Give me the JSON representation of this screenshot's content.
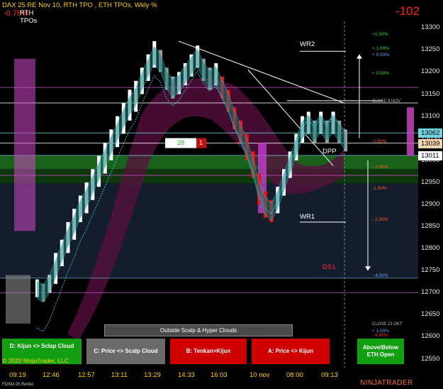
{
  "header": {
    "title": "DAX 25 RE Nov 10, RTH TPO , ETH TPOs, Wkly %",
    "change": "-0.78%",
    "rth_label": "RTH",
    "tpos_label": "TPOs",
    "points": "-102"
  },
  "chart_data": {
    "type": "candlestick",
    "instrument": "FDXM 25 Renko",
    "x_tick_labels": [
      "09:19",
      "12:46",
      "12:57",
      "13:11",
      "13:29",
      "14:33",
      "16:03",
      "10 nov",
      "08:00",
      "09:13"
    ],
    "y_tick_labels": [
      "13300",
      "13250",
      "13200",
      "13150",
      "13100",
      "13050",
      "13000",
      "12950",
      "12900",
      "12850",
      "12800",
      "12750",
      "12700",
      "12650",
      "12600",
      "12550"
    ],
    "ylim": [
      12530,
      13315
    ],
    "price_tags": [
      {
        "label": "13062",
        "value": 13062,
        "color": "#6fd4e0"
      },
      {
        "label": "13039",
        "value": 13039,
        "color": "#f2d6b0"
      },
      {
        "label": "13011",
        "value": 13011,
        "color": "#ffffff"
      }
    ],
    "level_labels": [
      {
        "label": "WR2",
        "value": 13250,
        "color": "#ffffff"
      },
      {
        "label": "WR1",
        "value": 12860,
        "color": "#ffffff"
      },
      {
        "label": "DPP",
        "value": 13007,
        "color": "#ffffff"
      },
      {
        "label": "DS1",
        "value": 12745,
        "color": "#ff3030"
      }
    ],
    "weekly_percent_levels": [
      {
        "label": "+1.50%",
        "value": 13285,
        "color": "#33dd33"
      },
      {
        "label": "+ 1.00%",
        "value": 13252,
        "color": "#33dd33"
      },
      {
        "label": "+ 0.00%",
        "value": 13237,
        "color": "#6fa0ff"
      },
      {
        "label": "+ 0.50%",
        "value": 13196,
        "color": "#33dd33"
      },
      {
        "label": "-0.50%",
        "value": 13041,
        "color": "#ff6030"
      },
      {
        "label": "- 1.00%",
        "value": 12983,
        "color": "#ff6030"
      },
      {
        "label": "-1.50%",
        "value": 12935,
        "color": "#ff6030"
      },
      {
        "label": "- 2.00%",
        "value": 12865,
        "color": "#ff6030"
      },
      {
        "label": "- 4.00%",
        "value": 12738,
        "color": "#6fa0ff"
      },
      {
        "label": "+ 1.00%",
        "value": 12612,
        "color": "#6fa0ff"
      },
      {
        "label": "- 4.90%",
        "value": 12602,
        "color": "#ff3030"
      }
    ],
    "annotations": [
      {
        "label": "CLOSE 9 NOV",
        "value": 13130
      },
      {
        "label": "CLOSE 23 OKT",
        "value": 12625
      },
      {
        "label": "28",
        "value": 13039,
        "color": "#22aa22"
      },
      {
        "label": "1",
        "value": 13039,
        "color": "#ff3030"
      }
    ],
    "horizontal_lines": [
      {
        "value": 13165,
        "color": "#c050c0"
      },
      {
        "value": 13130,
        "color": "#ffffff"
      },
      {
        "value": 13062,
        "color": "#6fd4e0"
      },
      {
        "value": 13039,
        "color": "#ffffff"
      },
      {
        "value": 13011,
        "color": "#6fd4e0"
      },
      {
        "value": 12966,
        "color": "#c050c0"
      },
      {
        "value": 12733,
        "color": "#5aa0d0"
      },
      {
        "value": 12700,
        "color": "#c050c0"
      }
    ],
    "zones": [
      {
        "from": 12980,
        "to": 13010,
        "color": "#1d6b1d"
      },
      {
        "from": 12948,
        "to": 12980,
        "color": "#0f3d0f"
      },
      {
        "from": 12733,
        "to": 12948,
        "color": "#152030"
      }
    ],
    "renko_bricks": [
      {
        "bar": 0,
        "low": 12690,
        "high": 12730,
        "up": true
      },
      {
        "bar": 1,
        "low": 12680,
        "high": 12720,
        "up": false
      },
      {
        "bar": 2,
        "low": 12700,
        "high": 12740,
        "up": true
      },
      {
        "bar": 3,
        "low": 12720,
        "high": 12790,
        "up": true
      },
      {
        "bar": 4,
        "low": 12760,
        "high": 12820,
        "up": true
      },
      {
        "bar": 5,
        "low": 12790,
        "high": 12860,
        "up": true
      },
      {
        "bar": 6,
        "low": 12820,
        "high": 12890,
        "up": true
      },
      {
        "bar": 7,
        "low": 12860,
        "high": 12920,
        "up": true
      },
      {
        "bar": 8,
        "low": 12880,
        "high": 12950,
        "up": true
      },
      {
        "bar": 9,
        "low": 12910,
        "high": 12980,
        "up": true
      },
      {
        "bar": 10,
        "low": 12940,
        "high": 13010,
        "up": true
      },
      {
        "bar": 11,
        "low": 12970,
        "high": 13040,
        "up": true
      },
      {
        "bar": 12,
        "low": 13000,
        "high": 13070,
        "up": true
      },
      {
        "bar": 13,
        "low": 13030,
        "high": 13100,
        "up": true
      },
      {
        "bar": 14,
        "low": 13060,
        "high": 13130,
        "up": true
      },
      {
        "bar": 15,
        "low": 13090,
        "high": 13160,
        "up": true
      },
      {
        "bar": 16,
        "low": 13110,
        "high": 13180,
        "up": true
      },
      {
        "bar": 17,
        "low": 13150,
        "high": 13210,
        "up": true
      },
      {
        "bar": 18,
        "low": 13180,
        "high": 13240,
        "up": true
      },
      {
        "bar": 19,
        "low": 13210,
        "high": 13270,
        "up": true
      },
      {
        "bar": 20,
        "low": 13200,
        "high": 13250,
        "up": false
      },
      {
        "bar": 21,
        "low": 13160,
        "high": 13210,
        "up": false
      },
      {
        "bar": 22,
        "low": 13140,
        "high": 13190,
        "up": false
      },
      {
        "bar": 23,
        "low": 13150,
        "high": 13200,
        "up": true
      },
      {
        "bar": 24,
        "low": 13170,
        "high": 13220,
        "up": true
      },
      {
        "bar": 25,
        "low": 13190,
        "high": 13240,
        "up": true
      },
      {
        "bar": 26,
        "low": 13210,
        "high": 13260,
        "up": true
      },
      {
        "bar": 27,
        "low": 13180,
        "high": 13230,
        "up": false
      },
      {
        "bar": 28,
        "low": 13160,
        "high": 13210,
        "up": false
      },
      {
        "bar": 29,
        "low": 13170,
        "high": 13220,
        "up": true
      },
      {
        "bar": 30,
        "low": 13140,
        "high": 13190,
        "up": false
      },
      {
        "bar": 31,
        "low": 13110,
        "high": 13160,
        "up": false
      },
      {
        "bar": 32,
        "low": 13070,
        "high": 13120,
        "up": false
      },
      {
        "bar": 33,
        "low": 13040,
        "high": 13090,
        "up": false
      },
      {
        "bar": 34,
        "low": 13000,
        "high": 13060,
        "up": false
      },
      {
        "bar": 35,
        "low": 12960,
        "high": 13020,
        "up": false
      },
      {
        "bar": 36,
        "low": 12900,
        "high": 12970,
        "up": false
      },
      {
        "bar": 37,
        "low": 12870,
        "high": 12930,
        "up": false
      },
      {
        "bar": 38,
        "low": 12860,
        "high": 12910,
        "up": false
      },
      {
        "bar": 39,
        "low": 12880,
        "high": 12940,
        "up": true
      },
      {
        "bar": 40,
        "low": 12920,
        "high": 12980,
        "up": true
      },
      {
        "bar": 41,
        "low": 12960,
        "high": 13020,
        "up": true
      },
      {
        "bar": 42,
        "low": 13000,
        "high": 13060,
        "up": true
      },
      {
        "bar": 43,
        "low": 13040,
        "high": 13100,
        "up": true
      },
      {
        "bar": 44,
        "low": 13060,
        "high": 13110,
        "up": true
      },
      {
        "bar": 45,
        "low": 13040,
        "high": 13090,
        "up": false
      },
      {
        "bar": 46,
        "low": 13060,
        "high": 13110,
        "up": true
      },
      {
        "bar": 47,
        "low": 13040,
        "high": 13090,
        "up": false
      },
      {
        "bar": 48,
        "low": 13060,
        "high": 13110,
        "up": true
      },
      {
        "bar": 49,
        "low": 13040,
        "high": 13090,
        "up": false
      },
      {
        "bar": 50,
        "low": 13020,
        "high": 13070,
        "up": false
      }
    ],
    "title": "",
    "xlabel": "",
    "ylabel": ""
  },
  "buttons": {
    "scalp_hyper": "Outside Scalp & Hyper Clouds",
    "kijun_scalp": "D: Kijun <> Sclap Cloud",
    "price_scalp": "C: Price <> Scalp Cloud",
    "tenkan_kijun": "B: Tenkan>Kijun",
    "price_kijun": "A: Price <> Kijun",
    "eth_open": "Above/Below ETH Open",
    "colors": {
      "green": "#12a012",
      "gray": "#6a6a6a",
      "red": "#d00000"
    }
  },
  "footer": {
    "copyright": "© 2020 NinjaTrader, LLC",
    "instrument": "FDXM 25 Renko",
    "brand": "NINJATRADER"
  }
}
